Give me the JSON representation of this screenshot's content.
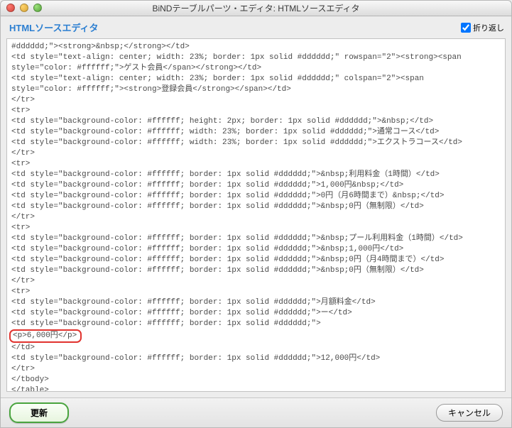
{
  "window": {
    "title": "BiNDテーブルパーツ・エディタ: HTMLソースエディタ"
  },
  "header": {
    "subtitle": "HTMLソースエディタ"
  },
  "wrap": {
    "label": "折り返し",
    "checked": true
  },
  "code": {
    "lines": [
      "#dddddd;\"><strong>&nbsp;</strong></td>",
      "<td style=\"text-align: center; width: 23%; border: 1px solid #dddddd;\" rowspan=\"2\"><strong><span",
      "style=\"color: #ffffff;\">ゲスト会員</span></strong></td>",
      "<td style=\"text-align: center; width: 23%; border: 1px solid #dddddd;\" colspan=\"2\"><span",
      "style=\"color: #ffffff;\"><strong>登録会員</strong></span></td>",
      "</tr>",
      "<tr>",
      "<td style=\"background-color: #ffffff; height: 2px; border: 1px solid #dddddd;\">&nbsp;</td>",
      "<td style=\"background-color: #ffffff; width: 23%; border: 1px solid #dddddd;\">通常コース</td>",
      "<td style=\"background-color: #ffffff; width: 23%; border: 1px solid #dddddd;\">エクストラコース</td>",
      "</tr>",
      "<tr>",
      "<td style=\"background-color: #ffffff; border: 1px solid #dddddd;\">&nbsp;利用料金（1時間）</td>",
      "<td style=\"background-color: #ffffff; border: 1px solid #dddddd;\">1,000円&nbsp;</td>",
      "<td style=\"background-color: #ffffff; border: 1px solid #dddddd;\">0円（月6時間まで）&nbsp;</td>",
      "<td style=\"background-color: #ffffff; border: 1px solid #dddddd;\">&nbsp;0円（無制限）</td>",
      "</tr>",
      "<tr>",
      "<td style=\"background-color: #ffffff; border: 1px solid #dddddd;\">&nbsp;プール利用料金（1時間）</td>",
      "<td style=\"background-color: #ffffff; border: 1px solid #dddddd;\">&nbsp;1,000円</td>",
      "<td style=\"background-color: #ffffff; border: 1px solid #dddddd;\">&nbsp;0円（月4時間まで）</td>",
      "<td style=\"background-color: #ffffff; border: 1px solid #dddddd;\">&nbsp;0円（無制限）</td>",
      "</tr>",
      "<tr>",
      "<td style=\"background-color: #ffffff; border: 1px solid #dddddd;\">月額料金</td>",
      "<td style=\"background-color: #ffffff; border: 1px solid #dddddd;\">ー</td>",
      "<td style=\"background-color: #ffffff; border: 1px solid #dddddd;\">"
    ],
    "highlight": "<p>6,000円</p>",
    "tail": [
      "</td>",
      "<td style=\"background-color: #ffffff; border: 1px solid #dddddd;\">12,000円</td>",
      "</tr>",
      "</tbody>",
      "</table>"
    ]
  },
  "buttons": {
    "update": "更新",
    "cancel": "キャンセル"
  }
}
